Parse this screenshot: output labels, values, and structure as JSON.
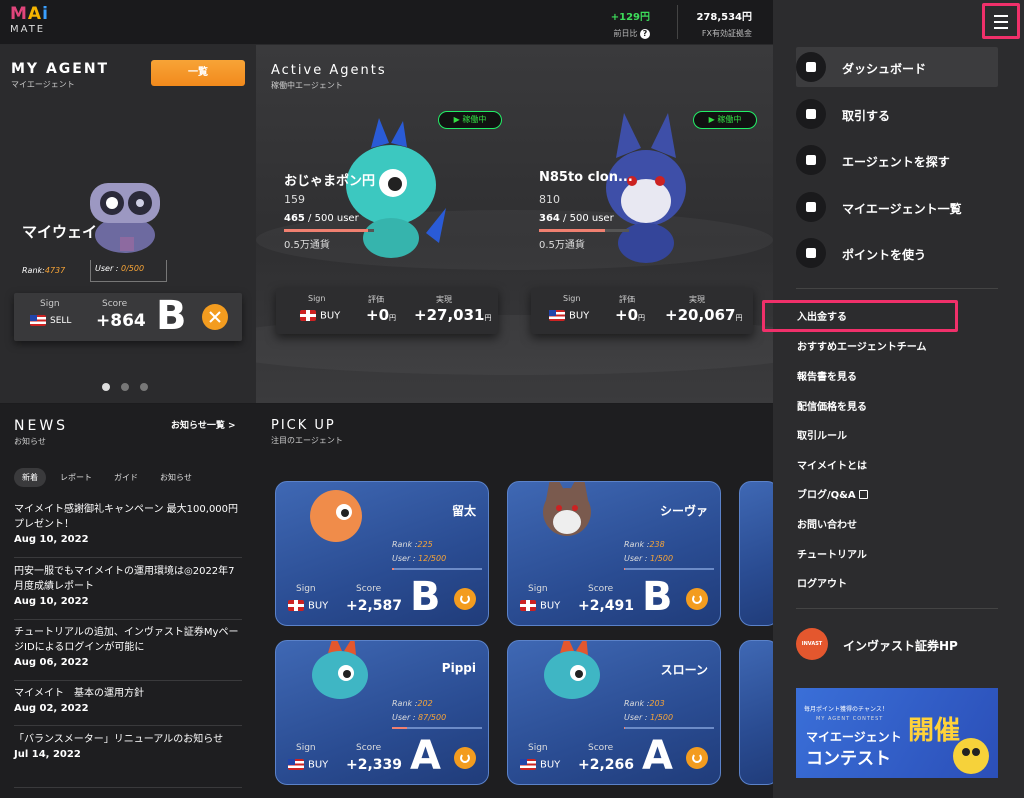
{
  "header": {
    "logo_top": "MAi",
    "logo_bottom": "MATE",
    "pnl_value": "+129円",
    "pnl_label": "前日比",
    "margin_value": "278,534円",
    "margin_label": "FX有効証拠金"
  },
  "my_agent": {
    "title": "MY AGENT",
    "subtitle": "マイエージェント",
    "list_button": "一覧",
    "agent_name": "マイウェイ",
    "rank_label": "Rank:",
    "rank_value": "4737",
    "user_label": "User : ",
    "user_value": "0/500",
    "sign_label": "Sign",
    "sign_value": "SELL",
    "score_label": "Score",
    "score_value": "+864",
    "grade": "B"
  },
  "active_agents": {
    "title": "Active Agents",
    "subtitle": "稼働中エージェント",
    "agents": [
      {
        "status": "稼働中",
        "name": "おじゃまポン円",
        "number": "159",
        "users": "465",
        "users_total": " / 500 user",
        "currency": "0.5万通貨",
        "sign_label": "Sign",
        "sign": "BUY",
        "eval_label": "評価",
        "eval": "+0",
        "real_label": "実現",
        "real": "+27,031",
        "unit": "円",
        "progress": 0.93
      },
      {
        "status": "稼働中",
        "name": "N85to clon...",
        "number": "810",
        "users": "364",
        "users_total": " / 500 user",
        "currency": "0.5万通貨",
        "sign_label": "Sign",
        "sign": "BUY",
        "eval_label": "評価",
        "eval": "+0",
        "real_label": "実現",
        "real": "+20,067",
        "unit": "円",
        "progress": 0.73
      }
    ]
  },
  "news": {
    "title": "NEWS",
    "subtitle": "お知らせ",
    "link": "お知らせ一覧 >",
    "tabs": [
      "新着",
      "レポート",
      "ガイド",
      "お知らせ"
    ],
    "items": [
      {
        "text": "マイメイト感謝御礼キャンペーン 最大100,000円プレゼント！",
        "date": "Aug 10, 2022"
      },
      {
        "text": "円安一服でもマイメイトの運用環境は◎2022年7月度成績レポート",
        "date": "Aug 10, 2022"
      },
      {
        "text": "チュートリアルの追加、インヴァスト証券MyページIDによるログインが可能に",
        "date": "Aug 06, 2022"
      },
      {
        "text": "マイメイト　基本の運用方針",
        "date": "Aug 02, 2022"
      },
      {
        "text": "「バランスメーター」リニューアルのお知らせ",
        "date": "Jul 14, 2022"
      }
    ]
  },
  "pickup": {
    "title": "PICK UP",
    "subtitle": "注目のエージェント",
    "cards": [
      {
        "name": "留太",
        "rank": "225",
        "users": "12/500",
        "sign": "BUY",
        "score": "+2,587",
        "grade": "B",
        "progress": 0.02,
        "flag": "gb"
      },
      {
        "name": "シーヴァ",
        "rank": "238",
        "users": "1/500",
        "sign": "BUY",
        "score": "+2,491",
        "grade": "B",
        "progress": 0.01,
        "flag": "gb"
      },
      {
        "name": "Pippi",
        "rank": "202",
        "users": "87/500",
        "sign": "BUY",
        "score": "+2,339",
        "grade": "A",
        "progress": 0.17,
        "flag": "us"
      },
      {
        "name": "スローン",
        "rank": "203",
        "users": "1/500",
        "sign": "BUY",
        "score": "+2,266",
        "grade": "A",
        "progress": 0.01,
        "flag": "us"
      }
    ],
    "rank_label": "Rank :",
    "user_label": "User : ",
    "sign_label": "Sign",
    "score_label": "Score"
  },
  "menu": {
    "primary": [
      "ダッシュボード",
      "取引する",
      "エージェントを探す",
      "マイエージェント一覧",
      "ポイントを使う"
    ],
    "links": [
      "入出金する",
      "おすすめエージェントチーム",
      "報告書を見る",
      "配信価格を見る",
      "取引ルール",
      "マイメイトとは",
      "ブログ/Q&A",
      "お問い合わせ",
      "チュートリアル",
      "ログアウト"
    ],
    "invest_logo": "INVAST",
    "invest": "インヴァスト証券HP",
    "banner_line1": "毎月ポイント獲得のチャンス！",
    "banner_line2": "MY AGENT CONTEST",
    "banner_line3": "マイエージェント",
    "banner_line4": "コンテスト",
    "banner_line5": "開催"
  }
}
